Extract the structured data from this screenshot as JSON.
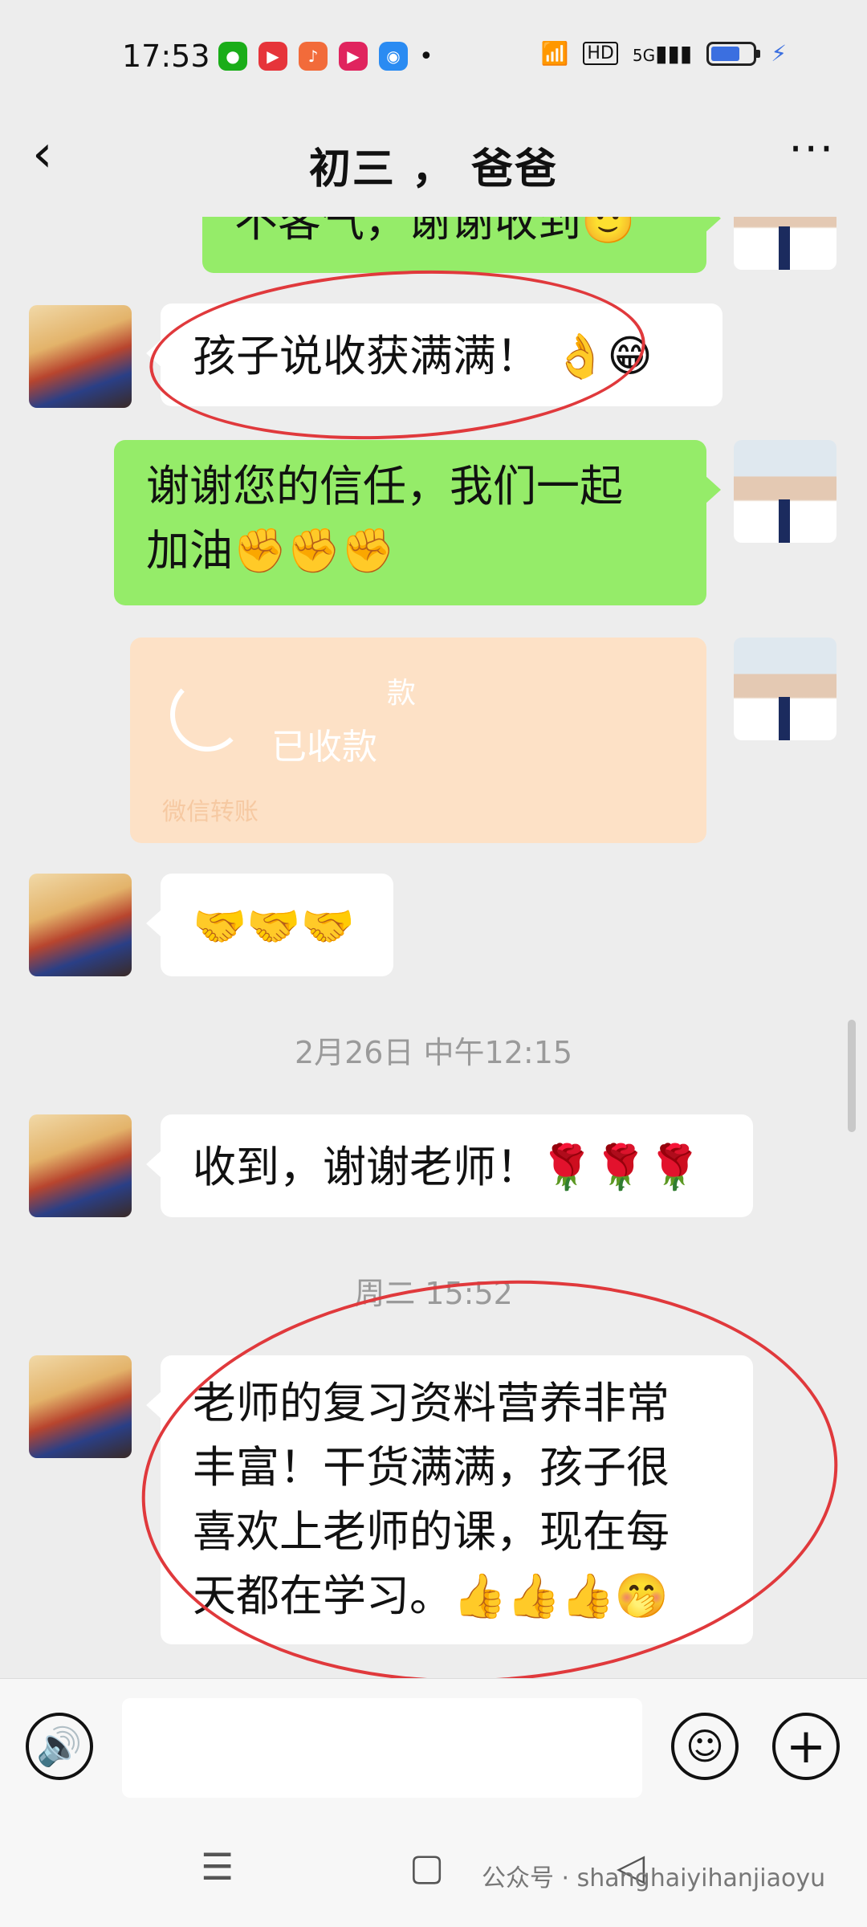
{
  "status_bar": {
    "time": "17:53",
    "dot": "•",
    "hd": "HD",
    "net": "5G",
    "icons": [
      "wechat-icon",
      "red-app-icon",
      "music-app-icon",
      "video-app-icon",
      "blue-app-icon",
      "wifi-icon",
      "signal-icon",
      "battery-icon",
      "charging-icon"
    ]
  },
  "header": {
    "back_icon": "‹",
    "title": "初三 ，   爸爸",
    "more_icon": "···"
  },
  "messages": {
    "m1": "不客气，谢谢收到🙂",
    "m2_text": "孩子说收获满满！",
    "m2_emoji": "👌😁",
    "m3_line1": "谢谢您的信任，我们一起",
    "m3_line2": "加油✊✊✊",
    "transfer_amount": "款",
    "transfer_status": "已收款",
    "transfer_label": "微信转账",
    "m4": "🤝🤝🤝",
    "ts1": "2月26日 中午12:15",
    "m5": "收到，谢谢老师！🌹🌹🌹",
    "ts2": "周二 15:52",
    "m6_line1": "老师的复习资料营养非常",
    "m6_line2": "丰富！干货满满，孩子很",
    "m6_line3": "喜欢上老师的课，现在每",
    "m6_line4": "天都在学习。👍👍👍🤭"
  },
  "input_bar": {
    "voice_icon": "voice-icon",
    "emoji_icon": "emoji-icon",
    "plus_icon": "plus-icon",
    "voice_glyph": "🔊",
    "emoji_glyph": "☺",
    "plus_glyph": "+"
  },
  "nav_bar": {
    "menu_glyph": "☰",
    "home_glyph": "▢",
    "back_glyph": "◁",
    "watermark": "公众号 · shanghaiyihanjiaoyu"
  },
  "colors": {
    "background": "#ededed",
    "green_bubble": "#95ec69",
    "transfer_bg": "#fde1c6",
    "annotation_red": "#e0393c"
  }
}
